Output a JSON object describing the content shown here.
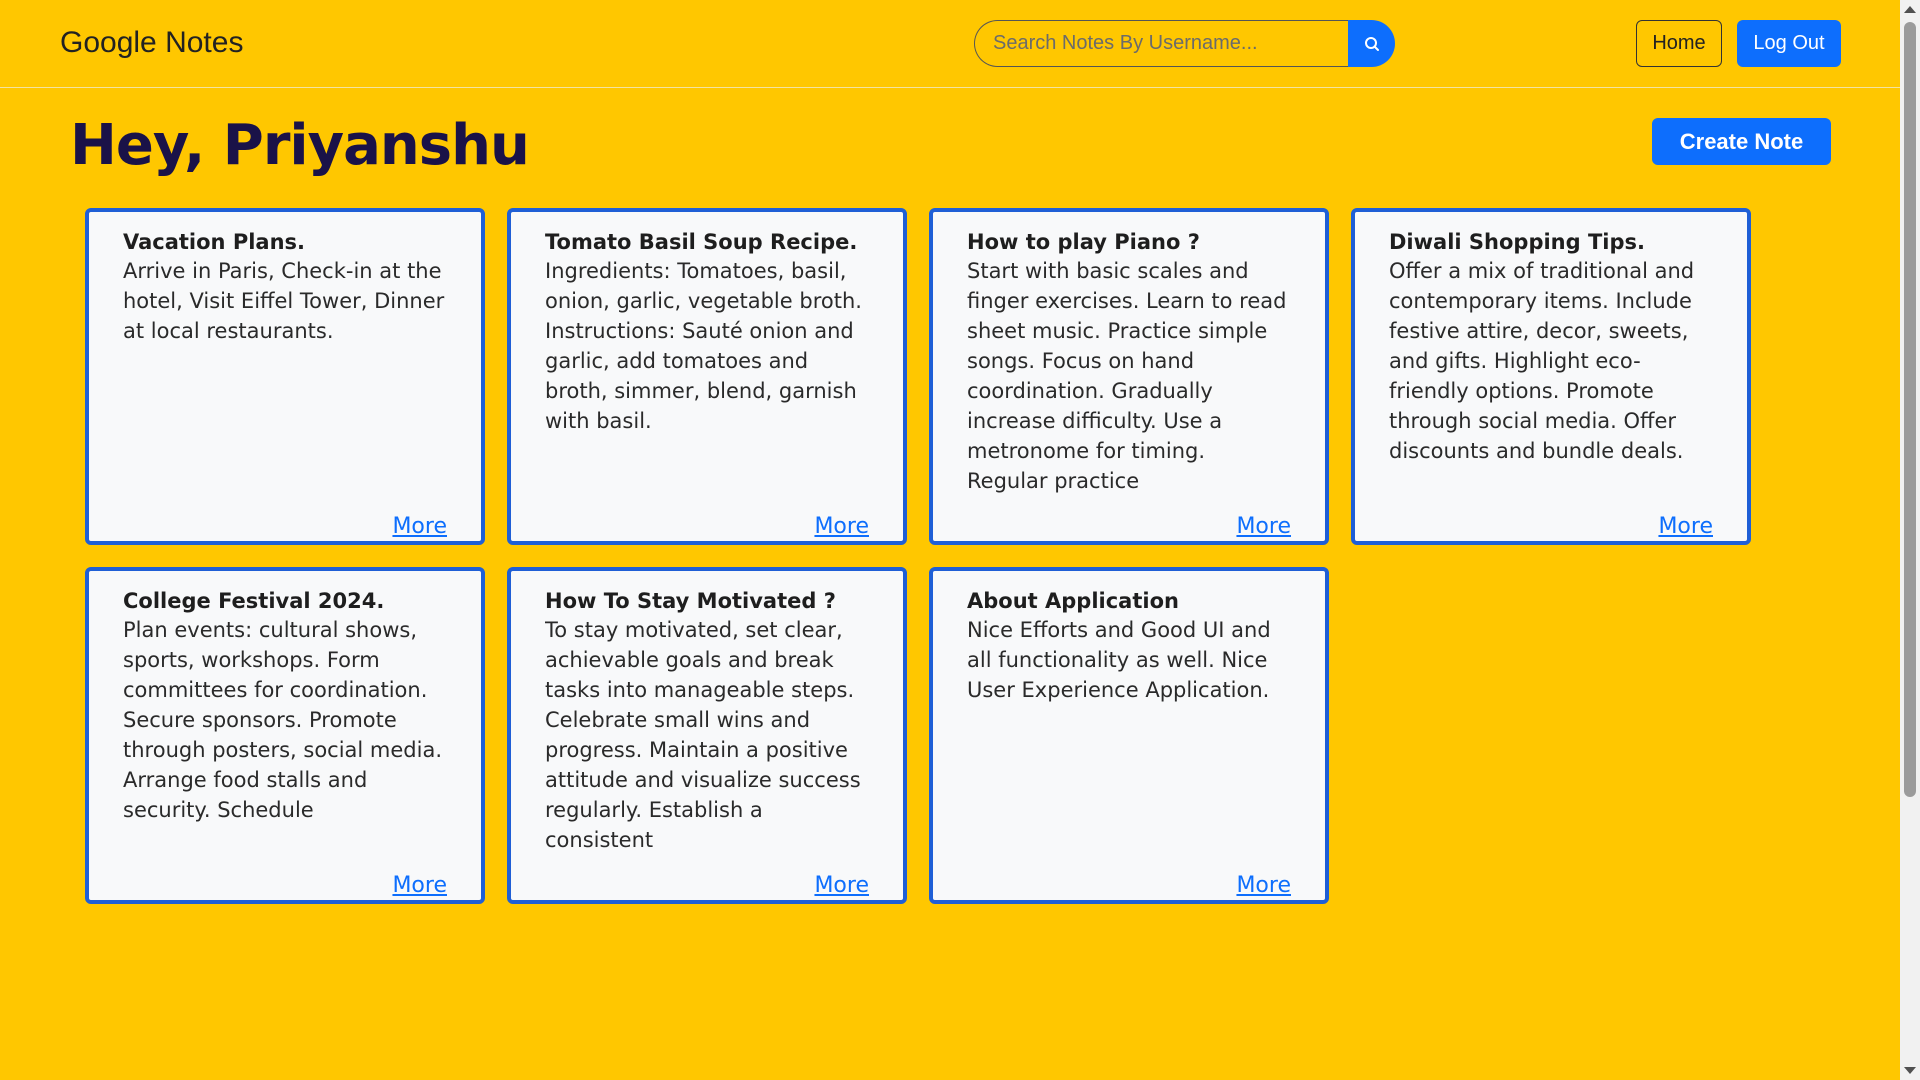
{
  "navbar": {
    "brand": "Google Notes",
    "search_placeholder": "Search Notes By Username...",
    "home_label": "Home",
    "logout_label": "Log Out"
  },
  "main": {
    "greeting": "Hey, Priyanshu",
    "create_label": "Create Note"
  },
  "notes": [
    {
      "title": "Vacation Plans.",
      "body": "Arrive in Paris, Check-in at the hotel, Visit Eiffel Tower, Dinner at local restaurants.",
      "more": "More"
    },
    {
      "title": "Tomato Basil Soup Recipe.",
      "body": "Ingredients: Tomatoes, basil, onion, garlic, vegetable broth. Instructions: Sauté onion and garlic, add tomatoes and broth, simmer, blend, garnish with basil.",
      "more": "More"
    },
    {
      "title": "How to play Piano ?",
      "body": "Start with basic scales and finger exercises. Learn to read sheet music. Practice simple songs. Focus on hand coordination. Gradually increase difficulty. Use a metronome for timing. Regular practice",
      "more": "More"
    },
    {
      "title": "Diwali Shopping Tips.",
      "body": "Offer a mix of traditional and contemporary items. Include festive attire, decor, sweets, and gifts. Highlight eco-friendly options. Promote through social media. Offer discounts and bundle deals.",
      "more": "More"
    },
    {
      "title": "College Festival 2024.",
      "body": "Plan events: cultural shows, sports, workshops. Form committees for coordination. Secure sponsors. Promote through posters, social media. Arrange food stalls and security. Schedule",
      "more": "More"
    },
    {
      "title": "How To Stay Motivated ?",
      "body": "To stay motivated, set clear, achievable goals and break tasks into manageable steps. Celebrate small wins and progress. Maintain a positive attitude and visualize success regularly. Establish a consistent",
      "more": "More"
    },
    {
      "title": "About Application",
      "body": "Nice Efforts and Good UI and all functionality as well. Nice User Experience Application.",
      "more": "More"
    }
  ],
  "colors": {
    "background": "#FFC700",
    "primary": "#0d6efd",
    "card_border": "#1f5fd6",
    "heading": "#1a1248"
  }
}
